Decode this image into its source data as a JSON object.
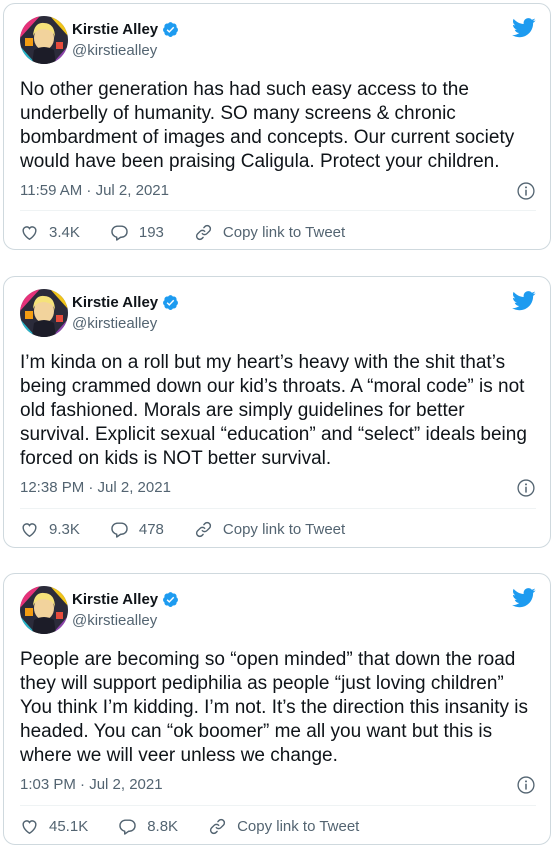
{
  "author": {
    "name": "Kirstie Alley",
    "handle": "@kirstiealley"
  },
  "tweets": [
    {
      "text": "No other generation has had such easy access to the underbelly of humanity. SO many screens & chronic bombardment of images and concepts. Our current society would have been praising Caligula. Protect your children.",
      "timestamp": "11:59 AM · Jul 2, 2021",
      "likes": "3.4K",
      "replies": "193",
      "copy_label": "Copy link to Tweet"
    },
    {
      "text": "I’m kinda on a roll but my heart’s heavy with the shit that’s being crammed down our kid’s throats. A “moral code” is not old fashioned. Morals are simply guidelines for better survival. Explicit sexual “education” and “select” ideals being forced on kids is NOT better survival.",
      "timestamp": "12:38 PM · Jul 2, 2021",
      "likes": "9.3K",
      "replies": "478",
      "copy_label": "Copy link to Tweet"
    },
    {
      "text": "People are becoming so “open minded” that down the road they will support pediphilia as people “just loving children” You think I’m kidding. I’m not. It’s the direction this insanity is headed. You can “ok boomer” me all you want but this is where we will veer unless we change.",
      "timestamp": "1:03 PM · Jul 2, 2021",
      "likes": "45.1K",
      "replies": "8.8K",
      "copy_label": "Copy link to Tweet"
    }
  ],
  "colors": {
    "brand_blue": "#1d9bf0",
    "text_primary": "#0f1419",
    "text_secondary": "#536471"
  },
  "icons": [
    "verified-icon",
    "twitter-bird-icon",
    "info-icon",
    "heart-icon",
    "reply-icon",
    "link-icon"
  ]
}
